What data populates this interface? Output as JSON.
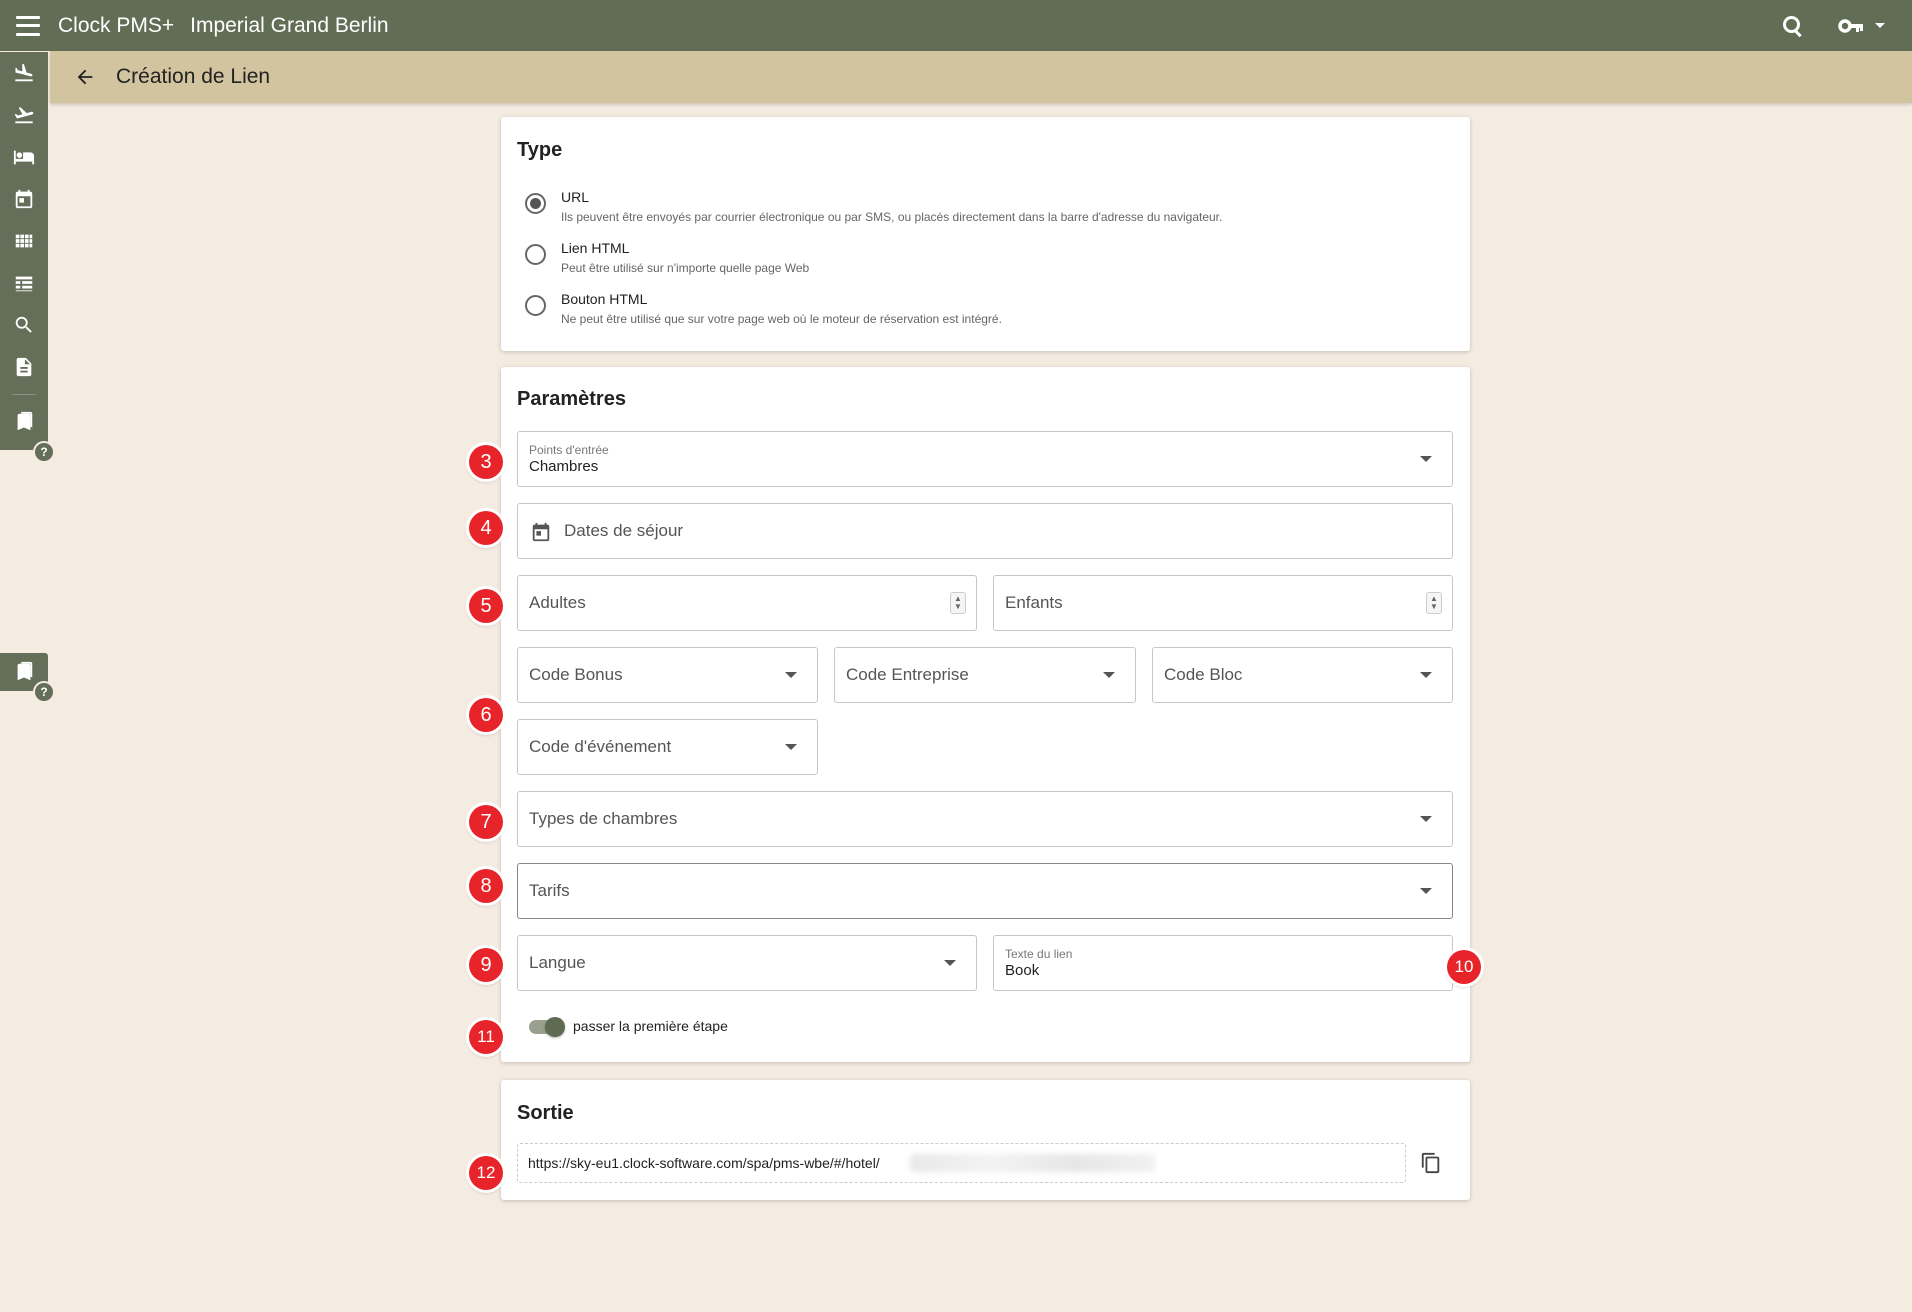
{
  "header": {
    "app_name": "Clock PMS+",
    "hotel_name": "Imperial Grand Berlin"
  },
  "subheader": {
    "title": "Création de Lien"
  },
  "icons": {
    "top": [
      "menu-icon",
      "search-icon",
      "key-icon",
      "dropdown-arrow-icon"
    ],
    "rail": [
      "arrival-icon",
      "departure-icon",
      "bed-icon",
      "calendar-icon",
      "grid-icon",
      "table-icon",
      "search-icon",
      "document-icon",
      "bookmark-icon"
    ]
  },
  "help_badge": "?",
  "type_section": {
    "title": "Type",
    "options": [
      {
        "label": "URL",
        "description": "Ils peuvent être envoyés par courrier électronique ou par SMS, ou placés directement dans la barre d'adresse du navigateur.",
        "selected": true
      },
      {
        "label": "Lien HTML",
        "description": "Peut être utilisé sur n'importe quelle page Web",
        "selected": false
      },
      {
        "label": "Bouton HTML",
        "description": "Ne peut être utilisé que sur votre page web où le moteur de réservation est intégré.",
        "selected": false
      }
    ]
  },
  "params": {
    "title": "Paramètres",
    "entry_points": {
      "label": "Points d'entrée",
      "value": "Chambres"
    },
    "stay_dates": {
      "placeholder": "Dates de séjour"
    },
    "adults": {
      "placeholder": "Adultes"
    },
    "children": {
      "placeholder": "Enfants"
    },
    "bonus_code": {
      "placeholder": "Code Bonus"
    },
    "company_code": {
      "placeholder": "Code Entreprise"
    },
    "block_code": {
      "placeholder": "Code Bloc"
    },
    "event_code": {
      "placeholder": "Code d'événement"
    },
    "room_types": {
      "placeholder": "Types de chambres"
    },
    "rates": {
      "placeholder": "Tarifs"
    },
    "language": {
      "placeholder": "Langue"
    },
    "link_text": {
      "label": "Texte du lien",
      "value": "Book"
    },
    "skip_first_step": {
      "label": "passer la première étape",
      "on": true
    }
  },
  "output": {
    "title": "Sortie",
    "url_visible": "https://sky-eu1.clock-software.com/spa/pms-wbe/#/hotel/"
  },
  "annotations": [
    "3",
    "4",
    "5",
    "6",
    "7",
    "8",
    "9",
    "10",
    "11",
    "12"
  ],
  "colors": {
    "topbar": "#626d55",
    "subheader": "#d3c4a0",
    "background": "#f4ebe1",
    "badge": "#e8242b"
  }
}
